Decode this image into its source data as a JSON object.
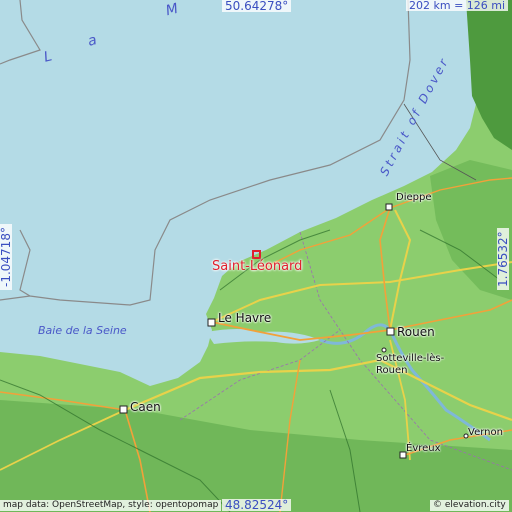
{
  "map": {
    "bounds": {
      "north": "50.64278°",
      "south": "48.82524°",
      "west": "-1.04718°",
      "east": "1.76532°"
    },
    "scale_label": "202 km = 126 mi",
    "attribution": "map data: OpenStreetMap, style: opentopomap",
    "attribution_right": "© elevation.city",
    "highlight": {
      "name": "Saint-Léonard",
      "color": "#e0202e"
    },
    "sea_labels": {
      "la_manche": [
        "L",
        "a",
        "M"
      ],
      "strait_of_dover": "Strait of Dover",
      "baie_de_la_seine": "Baie de la Seine"
    },
    "cities": {
      "dieppe": "Dieppe",
      "le_havre": "Le Havre",
      "rouen": "Rouen",
      "sotteville_line1": "Sotteville-lès-",
      "sotteville_line2": "Rouen",
      "caen": "Caen",
      "evreux": "Évreux",
      "vernon": "Vernon"
    },
    "colors": {
      "sea": "#b4dbe6",
      "land": "#8ccd6e",
      "land_dark": "#4e9a3e",
      "road_major": "#f2a13a",
      "road_motorway": "#e8d24a",
      "boundary": "#8a8a8a"
    }
  }
}
